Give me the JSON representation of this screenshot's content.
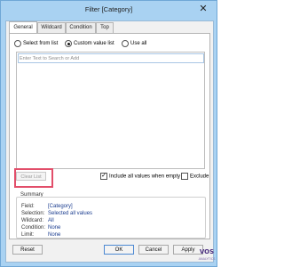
{
  "window": {
    "title": "Filter [Category]",
    "close_glyph": "✕"
  },
  "tabs": [
    "General",
    "Wildcard",
    "Condition",
    "Top"
  ],
  "mode": {
    "options": [
      "Select from list",
      "Custom value list",
      "Use all"
    ],
    "selected": "Custom value list"
  },
  "search": {
    "placeholder": "Enter Text to Search or Add",
    "value": ""
  },
  "buttons": {
    "clear_list": "Clear List",
    "reset": "Reset",
    "ok": "OK",
    "cancel": "Cancel",
    "apply": "Apply"
  },
  "options": {
    "include_all_label": "Include all values when empty",
    "include_all_checked": true,
    "exclude_label": "Exclude",
    "exclude_checked": false
  },
  "summary": {
    "title": "Summary",
    "rows": [
      {
        "key": "Field:",
        "value": "[Category]"
      },
      {
        "key": "Selection:",
        "value": "Selected all values"
      },
      {
        "key": "Wildcard:",
        "value": "All"
      },
      {
        "key": "Condition:",
        "value": "None"
      },
      {
        "key": "Limit:",
        "value": "None"
      }
    ]
  },
  "colors": {
    "highlight": "#e24e6a",
    "summary_value": "#1a3c8f",
    "frame": "#a9d2f2"
  },
  "watermark": {
    "text": "VOS",
    "sub": "ANALYTICS"
  }
}
